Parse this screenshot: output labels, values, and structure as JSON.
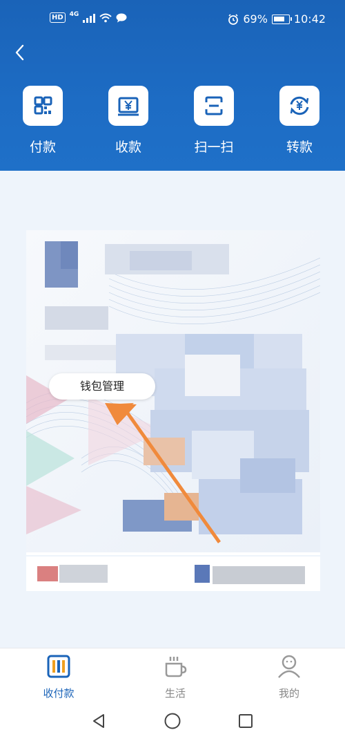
{
  "status_bar": {
    "hd": "HD",
    "network": "4G",
    "battery_percent": "69%",
    "time": "10:42"
  },
  "header": {
    "back_icon": "chevron-left-icon",
    "actions": [
      {
        "label": "付款",
        "icon": "qr-grid-icon"
      },
      {
        "label": "收款",
        "icon": "yuan-receipt-icon"
      },
      {
        "label": "扫一扫",
        "icon": "scan-icon"
      },
      {
        "label": "转款",
        "icon": "transfer-yuan-icon"
      }
    ]
  },
  "card": {
    "wallet_button_label": "钱包管理"
  },
  "bottom_nav": {
    "items": [
      {
        "label": "收付款",
        "icon": "pay-receive-icon",
        "active": true
      },
      {
        "label": "生活",
        "icon": "cup-icon",
        "active": false
      },
      {
        "label": "我的",
        "icon": "person-icon",
        "active": false
      }
    ],
    "active_color": "#1a63b8",
    "inactive_color": "#888888"
  },
  "system_nav": {
    "icons": [
      "back-triangle-icon",
      "home-circle-icon",
      "recents-square-icon"
    ]
  },
  "colors": {
    "header_blue": "#1a63b8",
    "arrow_orange": "#f08a3c"
  }
}
